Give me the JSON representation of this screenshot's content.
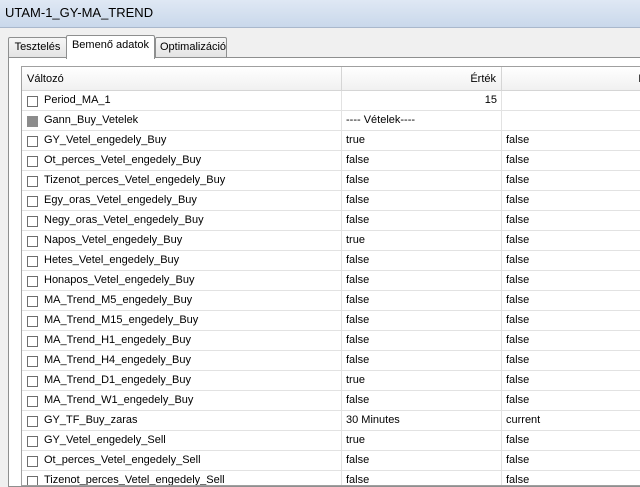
{
  "window": {
    "title": "UTAM-1_GY-MA_TREND"
  },
  "tabs": [
    {
      "label": "Tesztelés"
    },
    {
      "label": "Bemenő adatok"
    },
    {
      "label": "Optimalizáció"
    }
  ],
  "columns": {
    "variable": "Változó",
    "value": "Érték",
    "third": "Indi"
  },
  "rows": [
    {
      "name": "Period_MA_1",
      "value": "15",
      "extra": "",
      "disabled": false
    },
    {
      "name": "Gann_Buy_Vetelek",
      "value": "---- Vételek----",
      "extra": "",
      "disabled": true
    },
    {
      "name": "GY_Vetel_engedely_Buy",
      "value": "true",
      "extra": "false",
      "disabled": false
    },
    {
      "name": "Ot_perces_Vetel_engedely_Buy",
      "value": "false",
      "extra": "false",
      "disabled": false
    },
    {
      "name": "Tizenot_perces_Vetel_engedely_Buy",
      "value": "false",
      "extra": "false",
      "disabled": false
    },
    {
      "name": "Egy_oras_Vetel_engedely_Buy",
      "value": "false",
      "extra": "false",
      "disabled": false
    },
    {
      "name": "Negy_oras_Vetel_engedely_Buy",
      "value": "false",
      "extra": "false",
      "disabled": false
    },
    {
      "name": "Napos_Vetel_engedely_Buy",
      "value": "true",
      "extra": "false",
      "disabled": false
    },
    {
      "name": "Hetes_Vetel_engedely_Buy",
      "value": "false",
      "extra": "false",
      "disabled": false
    },
    {
      "name": "Honapos_Vetel_engedely_Buy",
      "value": "false",
      "extra": "false",
      "disabled": false
    },
    {
      "name": "MA_Trend_M5_engedely_Buy",
      "value": "false",
      "extra": "false",
      "disabled": false
    },
    {
      "name": "MA_Trend_M15_engedely_Buy",
      "value": "false",
      "extra": "false",
      "disabled": false
    },
    {
      "name": "MA_Trend_H1_engedely_Buy",
      "value": "false",
      "extra": "false",
      "disabled": false
    },
    {
      "name": "MA_Trend_H4_engedely_Buy",
      "value": "false",
      "extra": "false",
      "disabled": false
    },
    {
      "name": "MA_Trend_D1_engedely_Buy",
      "value": "true",
      "extra": "false",
      "disabled": false
    },
    {
      "name": "MA_Trend_W1_engedely_Buy",
      "value": "false",
      "extra": "false",
      "disabled": false
    },
    {
      "name": "GY_TF_Buy_zaras",
      "value": "30 Minutes",
      "extra": "current",
      "disabled": false
    },
    {
      "name": "GY_Vetel_engedely_Sell",
      "value": "true",
      "extra": "false",
      "disabled": false
    },
    {
      "name": "Ot_perces_Vetel_engedely_Sell",
      "value": "false",
      "extra": "false",
      "disabled": false
    },
    {
      "name": "Tizenot_perces_Vetel_engedely_Sell",
      "value": "false",
      "extra": "false",
      "disabled": false
    }
  ]
}
